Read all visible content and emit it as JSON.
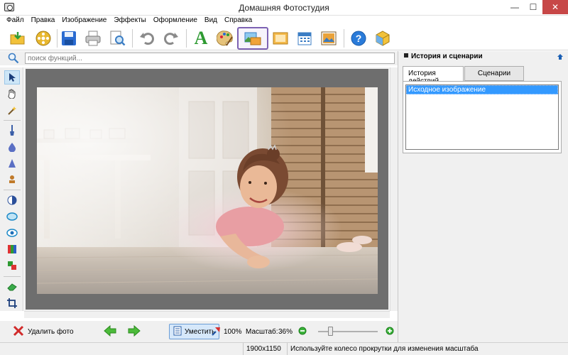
{
  "window": {
    "title": "Домашняя Фотостудия",
    "minimize": "—",
    "maximize": "☐",
    "close": "✕"
  },
  "menu": [
    "Файл",
    "Правка",
    "Изображение",
    "Эффекты",
    "Оформление",
    "Вид",
    "Справка"
  ],
  "toolbar": {
    "buttons": [
      "open-folder-icon",
      "film-reel-icon",
      "save-icon",
      "print-icon",
      "preview-icon",
      "undo-icon",
      "redo-icon",
      "text-effect-icon",
      "palette-icon",
      "image-frame-icon",
      "album-icon",
      "calendar-icon",
      "postcard-icon",
      "help-icon",
      "package-icon"
    ],
    "text_letter": "A"
  },
  "search": {
    "placeholder": "поиск функций..."
  },
  "right_panel": {
    "title": "История и сценарии",
    "tabs": [
      "История действий",
      "Сценарии"
    ],
    "history_items": [
      "Исходное изображение"
    ]
  },
  "bottom": {
    "delete_label": "Удалить фото",
    "fit_label": "Уместить",
    "zoom100_label": "100%",
    "scale_label": "Масштаб:",
    "scale_value": "36%",
    "zoom_level": 0.2
  },
  "status": {
    "dimensions": "1900x1150",
    "hint": "Используйте колесо прокрутки для изменения масштаба"
  },
  "colors": {
    "highlight_border": "#7d62b3",
    "selection": "#3399ff",
    "close_button": "#c74747"
  }
}
